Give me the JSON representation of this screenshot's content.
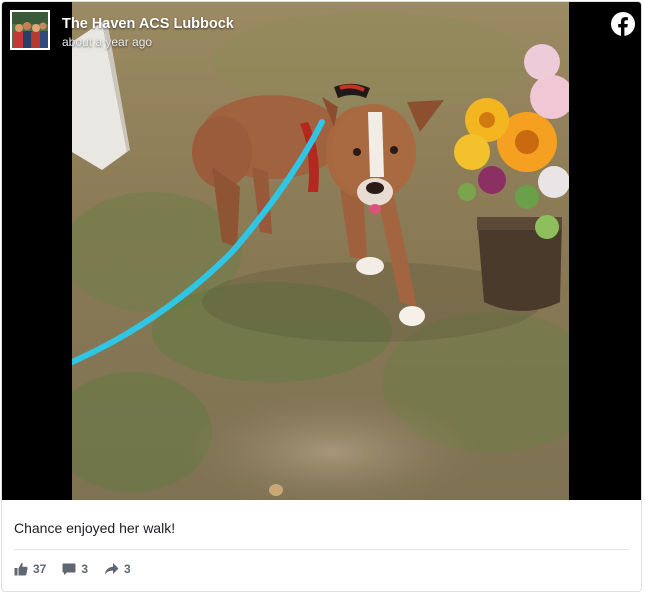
{
  "header": {
    "page_name": "The Haven ACS Lubbock",
    "timestamp": "about a year ago",
    "avatar_icon": "group-photo-avatar",
    "brand_icon": "facebook-icon"
  },
  "post": {
    "caption": "Chance enjoyed her walk!",
    "photo_description_icon": "dog-on-leash-photo"
  },
  "stats": {
    "likes": "37",
    "comments": "3",
    "shares": "3"
  },
  "colors": {
    "text_primary": "#1c1e21",
    "text_secondary": "#606770",
    "border": "#dddfe2",
    "letterbox": "#000000",
    "leash": "#2fc6e6"
  }
}
